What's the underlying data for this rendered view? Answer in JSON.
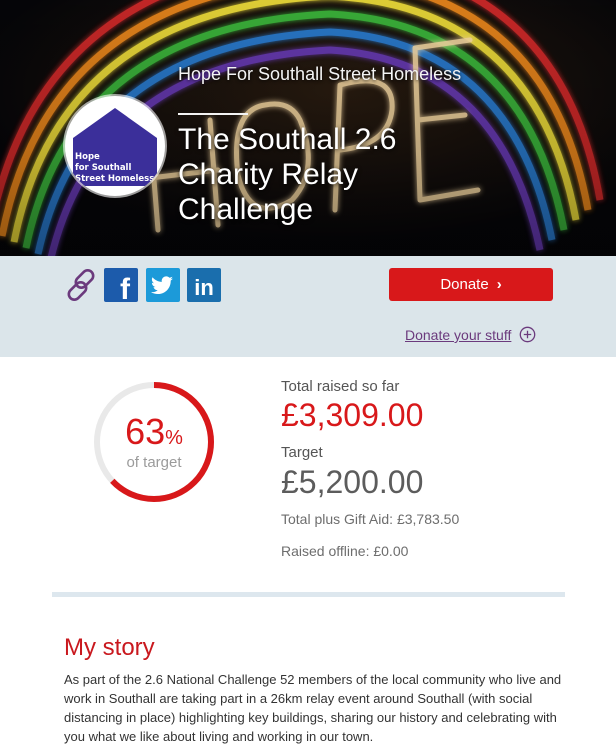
{
  "hero": {
    "charity_name": "Hope For Southall Street Homeless",
    "title": "The Southall 2.6 Charity Relay Challenge",
    "background_word": "HOPE",
    "avatar_text": [
      "Hope",
      "for Southall",
      "Street Homeless"
    ]
  },
  "share": {
    "icons": [
      "link-icon",
      "facebook-icon",
      "twitter-icon",
      "linkedin-icon"
    ],
    "facebook_glyph": "f",
    "linkedin_glyph": "in"
  },
  "actions": {
    "donate_label": "Donate",
    "donate_chevron": "›",
    "donate_stuff_label": "Donate your stuff"
  },
  "totals": {
    "percent": "63",
    "percent_symbol": "%",
    "percent_fraction": 0.63,
    "of_target_label": "of target",
    "raised_label": "Total raised so far",
    "raised_amount": "£3,309.00",
    "target_label": "Target",
    "target_amount": "£5,200.00",
    "gift_aid_text": "Total plus Gift Aid: £3,783.50",
    "offline_text": "Raised offline: £0.00"
  },
  "story": {
    "heading": "My story",
    "body": "As part of the 2.6 National Challenge 52 members of the local community who live and work in Southall are taking part in a 26km relay event around Southall (with social distancing in place) highlighting key buildings, sharing our history and celebrating with you what we like about living and working in our town."
  },
  "colors": {
    "brand_red": "#d8181a",
    "action_bar_bg": "#dbe5ea",
    "link_purple": "#6b3a7d",
    "ring_track": "#e9e9e9",
    "avatar_house": "#3b2f9a"
  }
}
